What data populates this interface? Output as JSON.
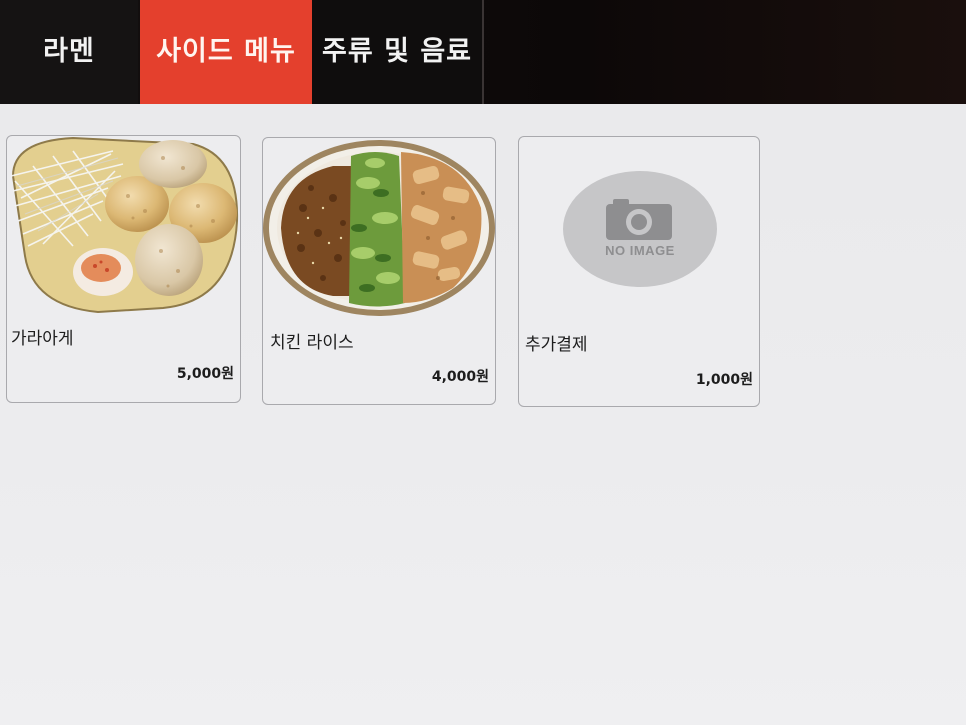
{
  "tabs": [
    {
      "label": "라멘",
      "active": false
    },
    {
      "label": "사이드 메뉴",
      "active": true
    },
    {
      "label": "주류 및 음료",
      "active": false
    }
  ],
  "colors": {
    "accent": "#e4402d",
    "topbar": "#0f0c0c",
    "background": "#ececee"
  },
  "menu_items": [
    {
      "name": "가라아게",
      "price": "5,000원",
      "image": "karaage-photo"
    },
    {
      "name": "치킨 라이스",
      "price": "4,000원",
      "image": "chicken-rice-photo"
    },
    {
      "name": "추가결제",
      "price": "1,000원",
      "image": "no-image-placeholder",
      "placeholder_text": "NO IMAGE"
    }
  ]
}
